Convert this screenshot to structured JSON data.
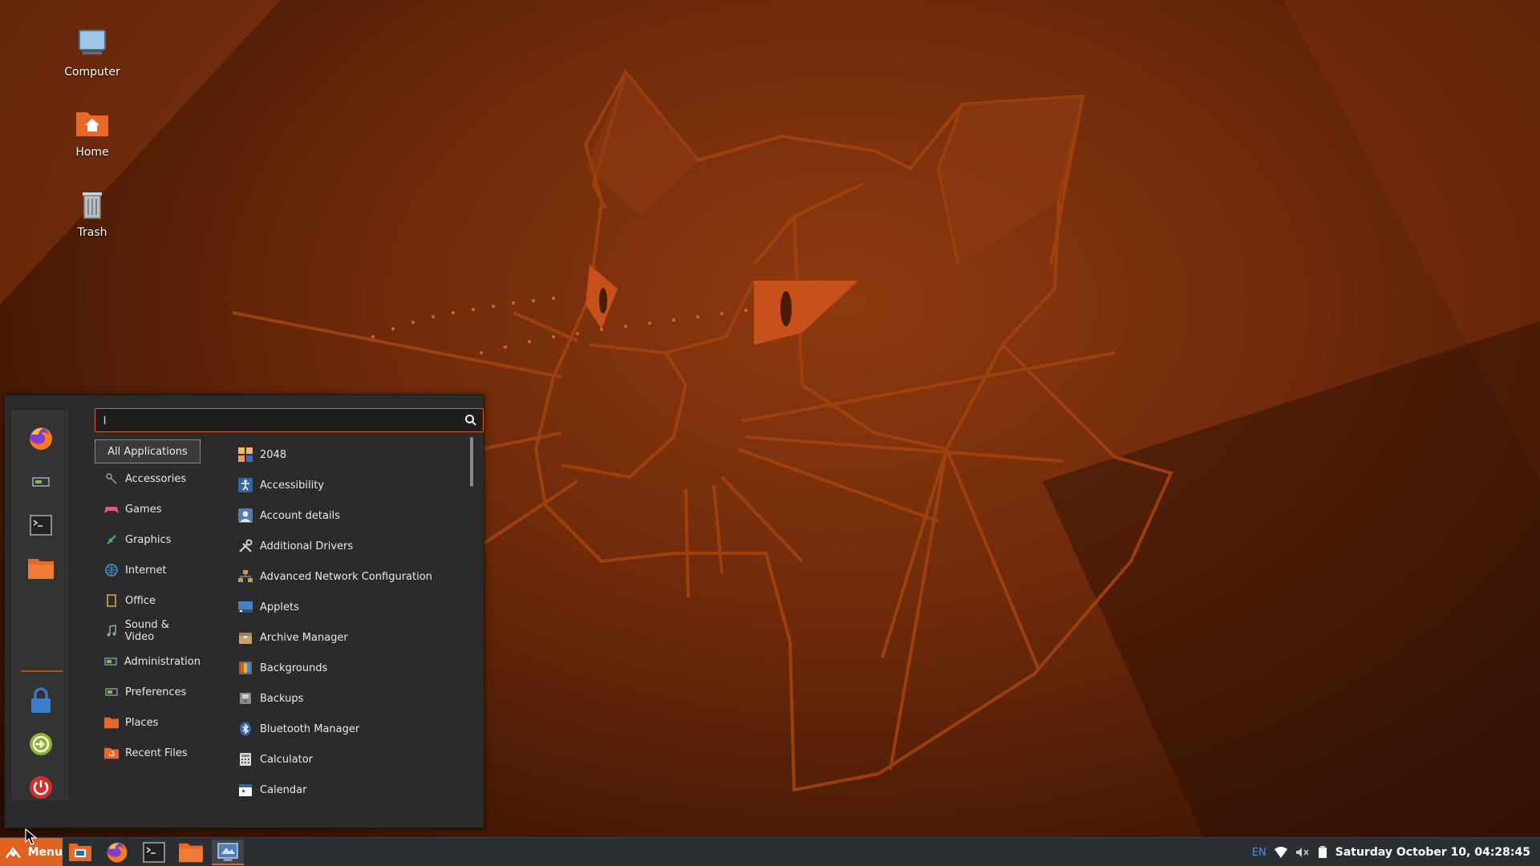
{
  "desktop": {
    "icons": [
      {
        "label": "Computer"
      },
      {
        "label": "Home"
      },
      {
        "label": "Trash"
      }
    ]
  },
  "menu": {
    "search": {
      "value": "l",
      "placeholder": ""
    },
    "categories": [
      {
        "label": "All Applications"
      },
      {
        "label": "Accessories"
      },
      {
        "label": "Games"
      },
      {
        "label": "Graphics"
      },
      {
        "label": "Internet"
      },
      {
        "label": "Office"
      },
      {
        "label": "Sound & Video"
      },
      {
        "label": "Administration"
      },
      {
        "label": "Preferences"
      },
      {
        "label": "Places"
      },
      {
        "label": "Recent Files"
      }
    ],
    "apps": [
      {
        "label": "2048"
      },
      {
        "label": "Accessibility"
      },
      {
        "label": "Account details"
      },
      {
        "label": "Additional Drivers"
      },
      {
        "label": "Advanced Network Configuration"
      },
      {
        "label": "Applets"
      },
      {
        "label": "Archive Manager"
      },
      {
        "label": "Backgrounds"
      },
      {
        "label": "Backups"
      },
      {
        "label": "Bluetooth Manager"
      },
      {
        "label": "Calculator"
      },
      {
        "label": "Calendar"
      }
    ],
    "favorites": [
      "firefox-icon",
      "system-settings-icon",
      "terminal-icon",
      "files-icon"
    ],
    "session": [
      "lock-screen-icon",
      "logout-icon",
      "shutdown-icon"
    ]
  },
  "taskbar": {
    "menu_label": "Menu",
    "language": "EN",
    "clock": "Saturday October 10, 04:28:45"
  },
  "colors": {
    "accent": "#e0621f",
    "panel": "#2a2f33",
    "menu_bg": "#2b2b2b"
  }
}
